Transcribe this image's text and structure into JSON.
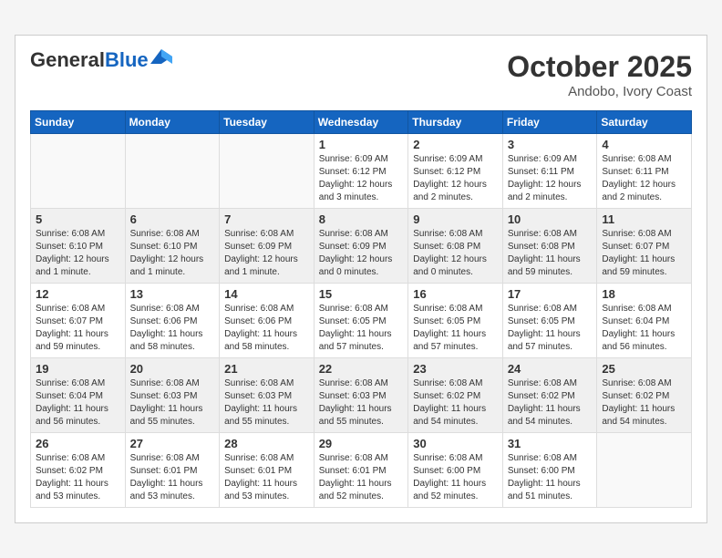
{
  "header": {
    "logo_general": "General",
    "logo_blue": "Blue",
    "month": "October 2025",
    "location": "Andobo, Ivory Coast"
  },
  "days_of_week": [
    "Sunday",
    "Monday",
    "Tuesday",
    "Wednesday",
    "Thursday",
    "Friday",
    "Saturday"
  ],
  "weeks": [
    [
      {
        "day": "",
        "info": ""
      },
      {
        "day": "",
        "info": ""
      },
      {
        "day": "",
        "info": ""
      },
      {
        "day": "1",
        "info": "Sunrise: 6:09 AM\nSunset: 6:12 PM\nDaylight: 12 hours and 3 minutes."
      },
      {
        "day": "2",
        "info": "Sunrise: 6:09 AM\nSunset: 6:12 PM\nDaylight: 12 hours and 2 minutes."
      },
      {
        "day": "3",
        "info": "Sunrise: 6:09 AM\nSunset: 6:11 PM\nDaylight: 12 hours and 2 minutes."
      },
      {
        "day": "4",
        "info": "Sunrise: 6:08 AM\nSunset: 6:11 PM\nDaylight: 12 hours and 2 minutes."
      }
    ],
    [
      {
        "day": "5",
        "info": "Sunrise: 6:08 AM\nSunset: 6:10 PM\nDaylight: 12 hours and 1 minute."
      },
      {
        "day": "6",
        "info": "Sunrise: 6:08 AM\nSunset: 6:10 PM\nDaylight: 12 hours and 1 minute."
      },
      {
        "day": "7",
        "info": "Sunrise: 6:08 AM\nSunset: 6:09 PM\nDaylight: 12 hours and 1 minute."
      },
      {
        "day": "8",
        "info": "Sunrise: 6:08 AM\nSunset: 6:09 PM\nDaylight: 12 hours and 0 minutes."
      },
      {
        "day": "9",
        "info": "Sunrise: 6:08 AM\nSunset: 6:08 PM\nDaylight: 12 hours and 0 minutes."
      },
      {
        "day": "10",
        "info": "Sunrise: 6:08 AM\nSunset: 6:08 PM\nDaylight: 11 hours and 59 minutes."
      },
      {
        "day": "11",
        "info": "Sunrise: 6:08 AM\nSunset: 6:07 PM\nDaylight: 11 hours and 59 minutes."
      }
    ],
    [
      {
        "day": "12",
        "info": "Sunrise: 6:08 AM\nSunset: 6:07 PM\nDaylight: 11 hours and 59 minutes."
      },
      {
        "day": "13",
        "info": "Sunrise: 6:08 AM\nSunset: 6:06 PM\nDaylight: 11 hours and 58 minutes."
      },
      {
        "day": "14",
        "info": "Sunrise: 6:08 AM\nSunset: 6:06 PM\nDaylight: 11 hours and 58 minutes."
      },
      {
        "day": "15",
        "info": "Sunrise: 6:08 AM\nSunset: 6:05 PM\nDaylight: 11 hours and 57 minutes."
      },
      {
        "day": "16",
        "info": "Sunrise: 6:08 AM\nSunset: 6:05 PM\nDaylight: 11 hours and 57 minutes."
      },
      {
        "day": "17",
        "info": "Sunrise: 6:08 AM\nSunset: 6:05 PM\nDaylight: 11 hours and 57 minutes."
      },
      {
        "day": "18",
        "info": "Sunrise: 6:08 AM\nSunset: 6:04 PM\nDaylight: 11 hours and 56 minutes."
      }
    ],
    [
      {
        "day": "19",
        "info": "Sunrise: 6:08 AM\nSunset: 6:04 PM\nDaylight: 11 hours and 56 minutes."
      },
      {
        "day": "20",
        "info": "Sunrise: 6:08 AM\nSunset: 6:03 PM\nDaylight: 11 hours and 55 minutes."
      },
      {
        "day": "21",
        "info": "Sunrise: 6:08 AM\nSunset: 6:03 PM\nDaylight: 11 hours and 55 minutes."
      },
      {
        "day": "22",
        "info": "Sunrise: 6:08 AM\nSunset: 6:03 PM\nDaylight: 11 hours and 55 minutes."
      },
      {
        "day": "23",
        "info": "Sunrise: 6:08 AM\nSunset: 6:02 PM\nDaylight: 11 hours and 54 minutes."
      },
      {
        "day": "24",
        "info": "Sunrise: 6:08 AM\nSunset: 6:02 PM\nDaylight: 11 hours and 54 minutes."
      },
      {
        "day": "25",
        "info": "Sunrise: 6:08 AM\nSunset: 6:02 PM\nDaylight: 11 hours and 54 minutes."
      }
    ],
    [
      {
        "day": "26",
        "info": "Sunrise: 6:08 AM\nSunset: 6:02 PM\nDaylight: 11 hours and 53 minutes."
      },
      {
        "day": "27",
        "info": "Sunrise: 6:08 AM\nSunset: 6:01 PM\nDaylight: 11 hours and 53 minutes."
      },
      {
        "day": "28",
        "info": "Sunrise: 6:08 AM\nSunset: 6:01 PM\nDaylight: 11 hours and 53 minutes."
      },
      {
        "day": "29",
        "info": "Sunrise: 6:08 AM\nSunset: 6:01 PM\nDaylight: 11 hours and 52 minutes."
      },
      {
        "day": "30",
        "info": "Sunrise: 6:08 AM\nSunset: 6:00 PM\nDaylight: 11 hours and 52 minutes."
      },
      {
        "day": "31",
        "info": "Sunrise: 6:08 AM\nSunset: 6:00 PM\nDaylight: 11 hours and 51 minutes."
      },
      {
        "day": "",
        "info": ""
      }
    ]
  ]
}
